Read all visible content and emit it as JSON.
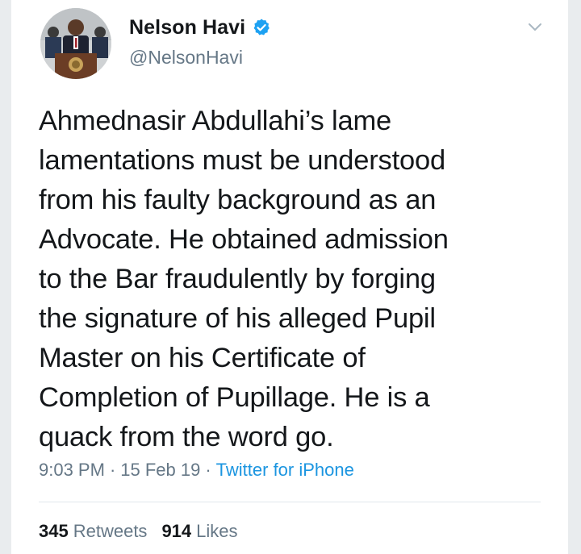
{
  "user": {
    "display_name": "Nelson Havi",
    "handle": "@NelsonHavi",
    "verified_icon": "verified-badge-icon",
    "avatar_icon": "profile-photo"
  },
  "tweet": {
    "text": "Ahmednasir Abdullahi’s lame\nlamentations must be understood\nfrom his faulty background as an\nAdvocate. He obtained admission\nto the Bar fraudulently by forging\nthe signature of his alleged Pupil\nMaster on his Certificate of\nCompletion of Pupillage. He is a\nquack from the word go.",
    "time": "9:03 PM",
    "date": "15 Feb 19",
    "source": "Twitter for iPhone",
    "separator": "·"
  },
  "stats": {
    "retweets_count": "345",
    "retweets_label": "Retweets",
    "likes_count": "914",
    "likes_label": "Likes"
  },
  "colors": {
    "text": "#14171a",
    "muted": "#657786",
    "link": "#1b95e0",
    "verified": "#1da1f2",
    "divider": "#e1e8ed"
  }
}
